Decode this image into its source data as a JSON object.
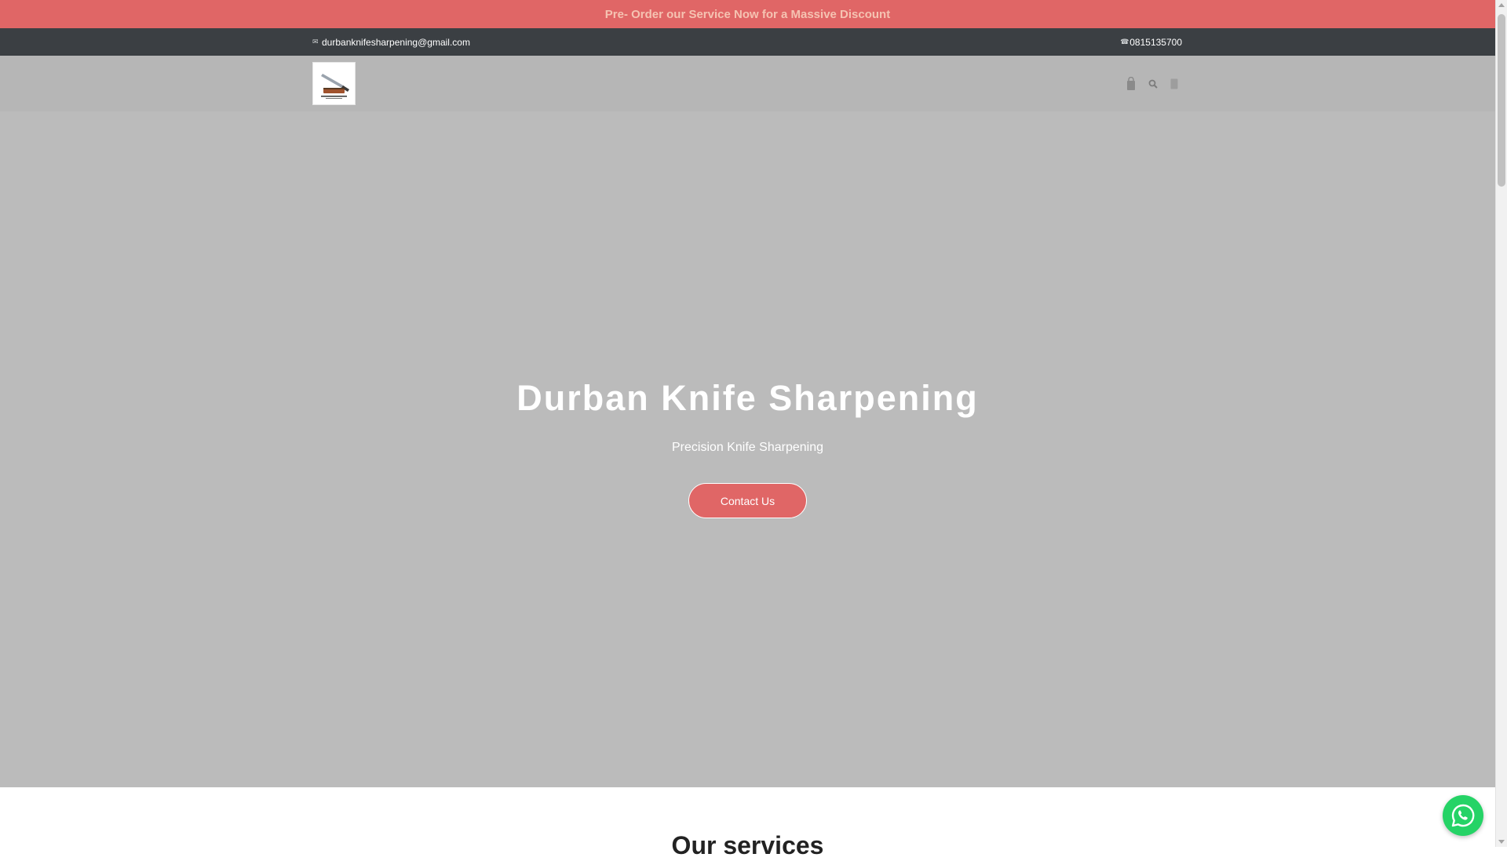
{
  "announcement": {
    "text": "Pre- Order our Service Now for a Massive Discount"
  },
  "topbar": {
    "email": "durbanknifesharpening@gmail.com",
    "email_icon": "envelope-icon",
    "phone": "0815135700",
    "phone_icon": "phone-icon"
  },
  "header": {
    "logo_alt": "Durban Knife Sharpening logo",
    "icons": [
      "cart-icon",
      "search-icon",
      "user-icon"
    ]
  },
  "hero": {
    "title": "Durban Knife Sharpening",
    "subtitle": "Precision Knife Sharpening",
    "cta_label": "Contact Us"
  },
  "services": {
    "heading": "Our services"
  },
  "floating": {
    "icon": "whatsapp-icon"
  },
  "colors": {
    "accent": "#e06666",
    "announcement_text": "#f5c3b2",
    "topbar_bg": "#3b3f43",
    "header_bg": "#b6b6b6",
    "hero_bg": "#bbbbbb",
    "whatsapp": "#25d366"
  }
}
